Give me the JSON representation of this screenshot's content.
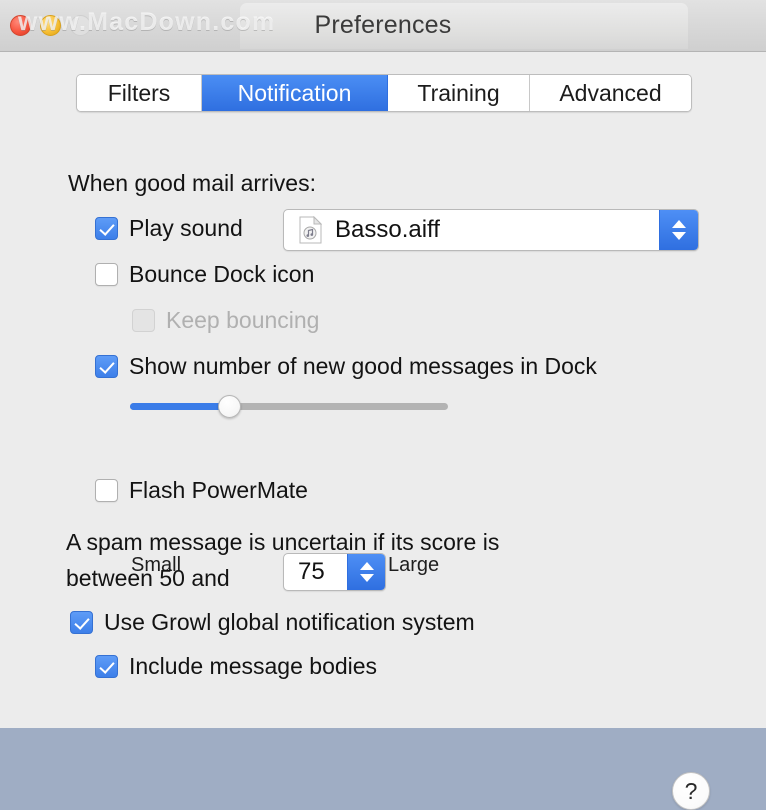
{
  "window": {
    "title": "Preferences",
    "watermark": "www.MacDown.com",
    "traffic_lights": {
      "close": "close-button",
      "minimize": "minimize-button",
      "zoom": "zoom-button"
    }
  },
  "tabs": [
    {
      "label": "Filters",
      "selected": false
    },
    {
      "label": "Notification",
      "selected": true
    },
    {
      "label": "Training",
      "selected": false
    },
    {
      "label": "Advanced",
      "selected": false
    }
  ],
  "main": {
    "section_heading": "When good mail arrives:",
    "play_sound": {
      "label": "Play sound",
      "checked": true,
      "sound_value": "Basso.aiff",
      "icon": "audio-file-icon"
    },
    "bounce_dock": {
      "label": "Bounce Dock icon",
      "checked": false
    },
    "keep_bouncing": {
      "label": "Keep bouncing",
      "checked": false,
      "disabled": true
    },
    "show_number": {
      "label": "Show number of new good messages in Dock",
      "checked": true
    },
    "size_slider": {
      "min_label": "Small",
      "max_label": "Large",
      "value_percent": 31
    },
    "flash_powermate": {
      "label": "Flash PowerMate",
      "checked": false
    },
    "uncertain_text_line1": "A spam message is uncertain if its score is",
    "uncertain_text_line2": "between 50 and",
    "uncertain_value": "75",
    "growl": {
      "label": "Use Growl global notification system",
      "checked": true
    },
    "include_bodies": {
      "label": "Include message bodies",
      "checked": true
    },
    "help_label": "?"
  },
  "colors": {
    "accent_blue": "#3d7fe9",
    "selected_tab_blue": "#2f6fe0",
    "window_background": "#ececec",
    "slider_fill": "#3a7ce8",
    "disabled_text": "#b0b0b0"
  }
}
